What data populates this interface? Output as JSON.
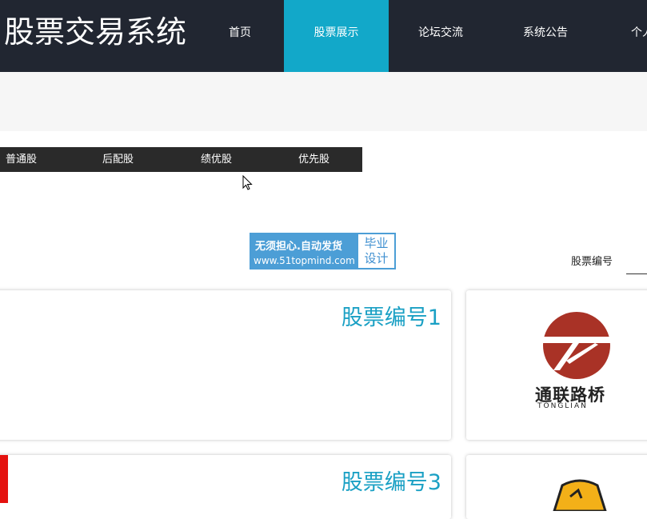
{
  "header": {
    "brand": "股票交易系统",
    "nav": [
      {
        "label": "首页",
        "active": false
      },
      {
        "label": "股票展示",
        "active": true
      },
      {
        "label": "论坛交流",
        "active": false
      },
      {
        "label": "系统公告",
        "active": false
      },
      {
        "label": "个人",
        "active": false
      }
    ]
  },
  "subnav": {
    "items": [
      "普通股",
      "后配股",
      "绩优股",
      "优先股"
    ]
  },
  "ad": {
    "line1": "无须担心.自动发货",
    "line2": "www.51topmind.com",
    "box_line1": "毕业",
    "box_line2": "设计"
  },
  "search": {
    "label": "股票编号",
    "value": ""
  },
  "cards": [
    {
      "title": "股票编号1"
    },
    {
      "logo_text": "通联路桥",
      "logo_sub": "TONGLIAN"
    },
    {
      "title": "股票编号3"
    },
    {}
  ],
  "colors": {
    "topbar": "#212631",
    "active_nav": "#12a8c9",
    "card_title": "#1aa0c4",
    "logo_red": "#a93226"
  },
  "icons": [
    "mouse-cursor-icon",
    "tonglian-logo",
    "gold-logo"
  ]
}
